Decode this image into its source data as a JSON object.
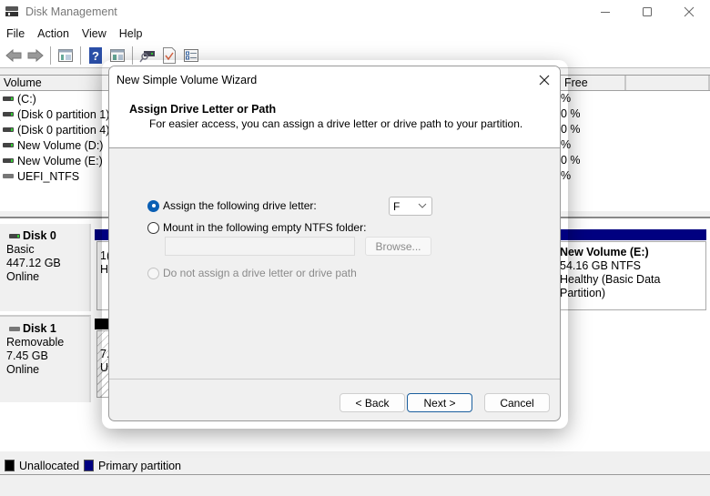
{
  "window": {
    "title": "Disk Management",
    "minimize_icon": "minimize-icon",
    "maximize_icon": "maximize-icon",
    "close_icon": "close-icon"
  },
  "menu": [
    "File",
    "Action",
    "View",
    "Help"
  ],
  "toolbar": {
    "icons": [
      "back-arrow-icon",
      "forward-arrow-icon",
      "console-tree-icon",
      "help-icon",
      "action-pane-icon",
      "connect-drive-icon",
      "properties-check-icon",
      "list-view-icon"
    ]
  },
  "volume_list": {
    "columns": [
      "Volume",
      "Free",
      ""
    ],
    "rows": [
      {
        "name": "(C:)",
        "free": "%",
        "icon": "green"
      },
      {
        "name": "(Disk 0 partition 1)",
        "free": "0 %",
        "icon": "green"
      },
      {
        "name": "(Disk 0 partition 4)",
        "free": "0 %",
        "icon": "green"
      },
      {
        "name": "New Volume (D:)",
        "free": "%",
        "icon": "green"
      },
      {
        "name": "New Volume (E:)",
        "free": "0 %",
        "icon": "green"
      },
      {
        "name": "UEFI_NTFS",
        "free": "%",
        "icon": "gray"
      }
    ]
  },
  "disks": [
    {
      "name": "Disk 0",
      "type": "Basic",
      "size": "447.12 GB",
      "status": "Online",
      "partial_partition_text": [
        "1(",
        "H"
      ],
      "visible_partition": {
        "title": "New Volume  (E:)",
        "size": "54.16 GB NTFS",
        "status": "Healthy (Basic Data Partition)"
      }
    },
    {
      "name": "Disk 1",
      "type": "Removable",
      "size": "7.45 GB",
      "status": "Online",
      "partial_partition_text": [
        "7.",
        "U"
      ]
    }
  ],
  "legend": [
    {
      "label": "Unallocated",
      "color": "#000000"
    },
    {
      "label": "Primary partition",
      "color": "#000080"
    }
  ],
  "dialog": {
    "title": "New Simple Volume Wizard",
    "heading": "Assign Drive Letter or Path",
    "subheading": "For easier access, you can assign a drive letter or drive path to your partition.",
    "options": {
      "assign_letter": {
        "label": "Assign the following drive letter:",
        "checked": true
      },
      "mount_folder": {
        "label": "Mount in the following empty NTFS folder:",
        "checked": false
      },
      "no_assign": {
        "label": "Do not assign a drive letter or drive path",
        "checked": false,
        "disabled": true
      }
    },
    "drive_letter_selected": "F",
    "folder_path_value": "",
    "browse_label": "Browse...",
    "back_label": "< Back",
    "next_label": "Next >",
    "cancel_label": "Cancel"
  },
  "colors": {
    "primary_partition": "#000080",
    "unallocated": "#000000",
    "accent": "#0a5fb4"
  }
}
